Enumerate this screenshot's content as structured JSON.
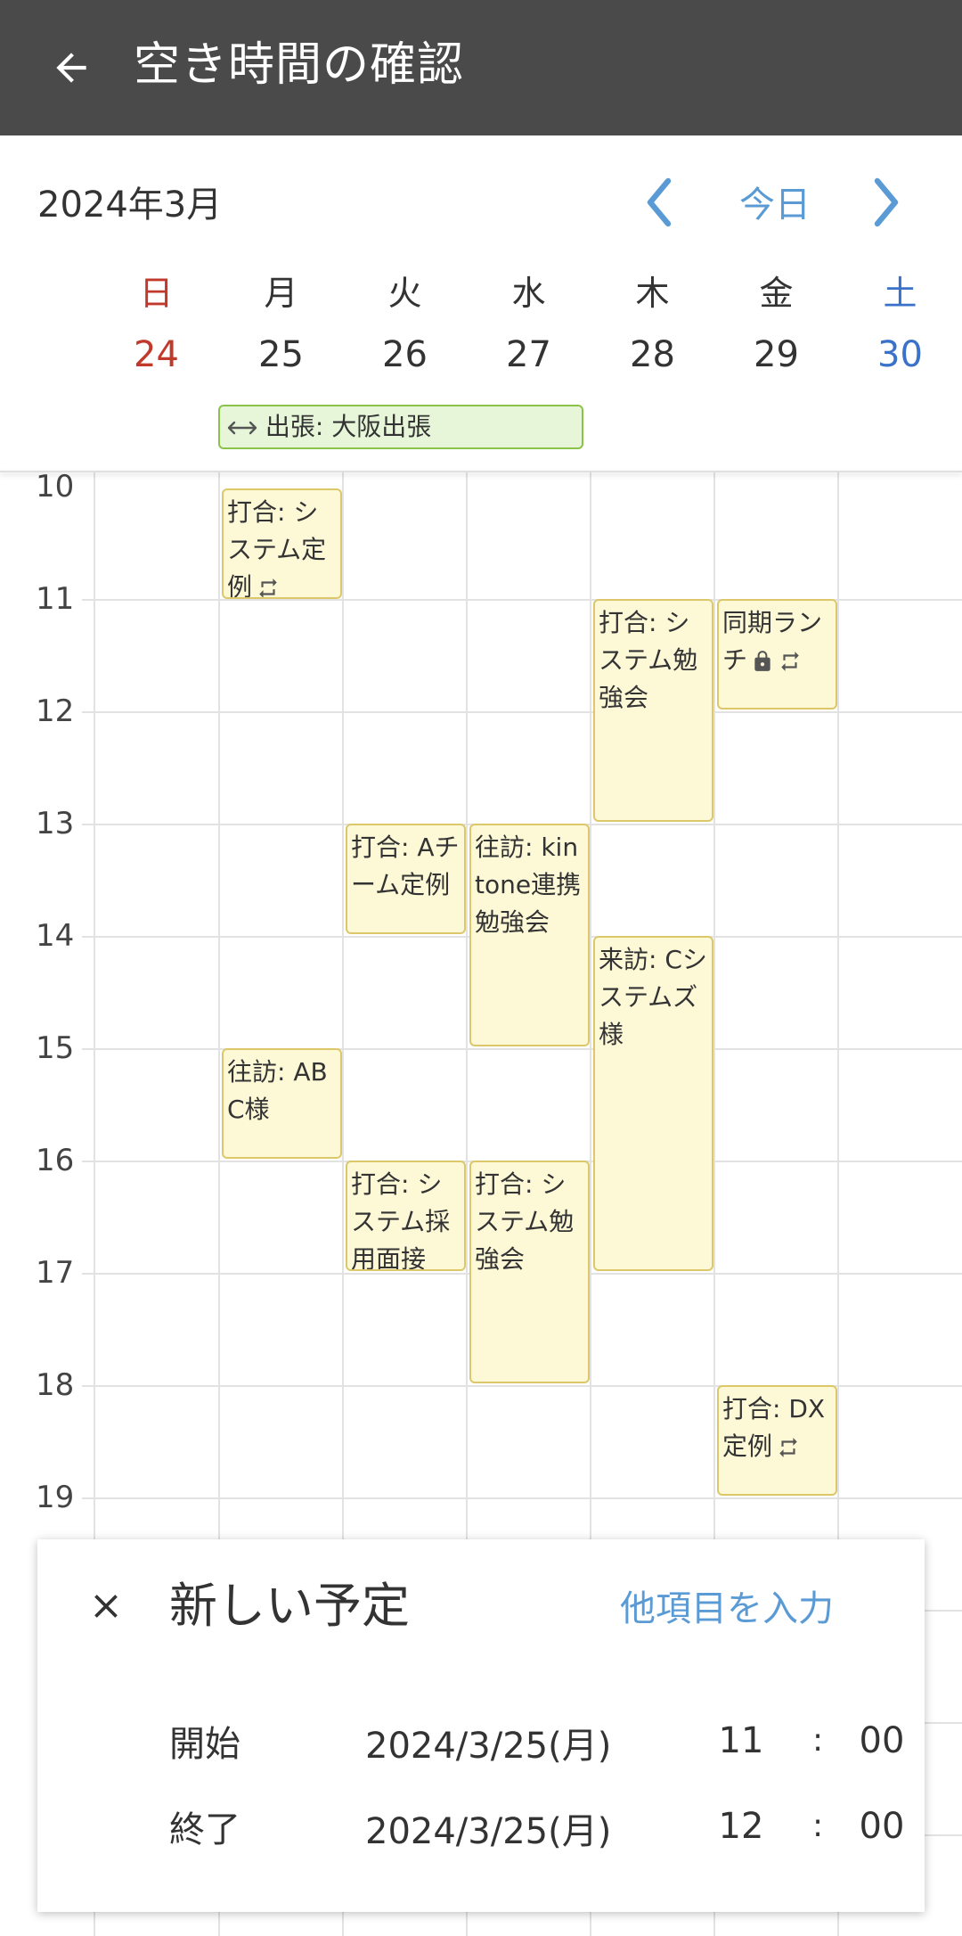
{
  "appbar": {
    "title": "空き時間の確認",
    "back_icon": "arrow-left-icon"
  },
  "calendar": {
    "month": "2024年3月",
    "today_label": "今日",
    "days": [
      {
        "dow": "日",
        "date": "24"
      },
      {
        "dow": "月",
        "date": "25"
      },
      {
        "dow": "火",
        "date": "26"
      },
      {
        "dow": "水",
        "date": "27"
      },
      {
        "dow": "木",
        "date": "28"
      },
      {
        "dow": "金",
        "date": "29"
      },
      {
        "dow": "土",
        "date": "30"
      }
    ],
    "allday_event": {
      "title": "出張: 大阪出張",
      "icon": "double-arrow-icon"
    },
    "hours": [
      "10",
      "11",
      "12",
      "13",
      "14",
      "15",
      "16",
      "17",
      "18",
      "19"
    ],
    "events": [
      {
        "title": "打合: システム定例",
        "icon": "repeat-icon"
      },
      {
        "title": "往訪: ABC様"
      },
      {
        "title": "打合: Aチーム定例"
      },
      {
        "title": "打合: システム採用面接"
      },
      {
        "title": "往訪: kintone連携勉強会"
      },
      {
        "title": "打合: システム勉強会"
      },
      {
        "title": "打合: システム勉強会"
      },
      {
        "title": "来訪: Cシステムズ様"
      },
      {
        "title": "同期ランチ",
        "icons": [
          "lock-icon",
          "repeat-icon"
        ]
      },
      {
        "title": "打合: DX定例",
        "icon": "repeat-icon"
      }
    ],
    "colors": {
      "sunday": "#c0392b",
      "saturday": "#3a72c9",
      "accent": "#5b9bd5",
      "event_bg": "#fdf8d6",
      "allday_bg": "#e7f6d9"
    }
  },
  "new_event": {
    "title": "新しい予定",
    "more_link": "他項目を入力",
    "start": {
      "label": "開始",
      "date": "2024/3/25(月)",
      "hour": "11",
      "minute": "00"
    },
    "end": {
      "label": "終了",
      "date": "2024/3/25(月)",
      "hour": "12",
      "minute": "00"
    },
    "separator": ":"
  }
}
